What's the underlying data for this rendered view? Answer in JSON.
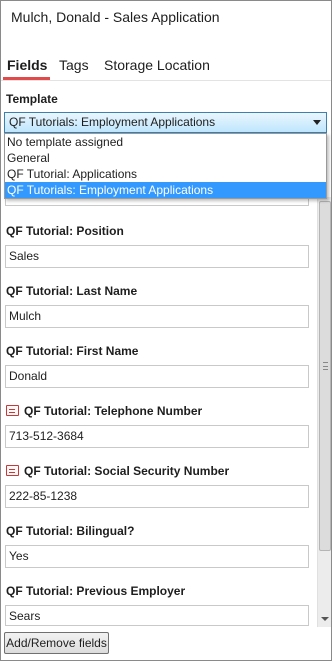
{
  "window": {
    "title": "Mulch, Donald - Sales Application"
  },
  "tabs": [
    {
      "label": "Fields"
    },
    {
      "label": "Tags"
    },
    {
      "label": "Storage Location"
    }
  ],
  "template": {
    "label": "Template",
    "selected": "QF Tutorials: Employment Applications",
    "options": [
      "No template assigned",
      "General",
      "QF Tutorial: Applications",
      "QF Tutorials: Employment Applications"
    ]
  },
  "fields": [
    {
      "label": "QF Tutorial: Position",
      "value": "Sales",
      "icon": ""
    },
    {
      "label": "QF Tutorial: Last Name",
      "value": "Mulch",
      "icon": ""
    },
    {
      "label": "QF Tutorial: First Name",
      "value": "Donald",
      "icon": ""
    },
    {
      "label": "QF Tutorial: Telephone Number",
      "value": "713-512-3684",
      "icon": "field-list-icon"
    },
    {
      "label": "QF Tutorial: Social Security Number",
      "value": "222-85-1238",
      "icon": "field-list-icon"
    },
    {
      "label": "QF Tutorial: Bilingual?",
      "value": "Yes",
      "icon": ""
    },
    {
      "label": "QF Tutorial: Previous Employer",
      "value": "Sears",
      "icon": ""
    }
  ],
  "footer": {
    "add_remove_label": "Add/Remove fields"
  },
  "colors": {
    "accent_underline": "#e04a4a",
    "selection": "#3399ff",
    "field_icon": "#c23a3a"
  }
}
